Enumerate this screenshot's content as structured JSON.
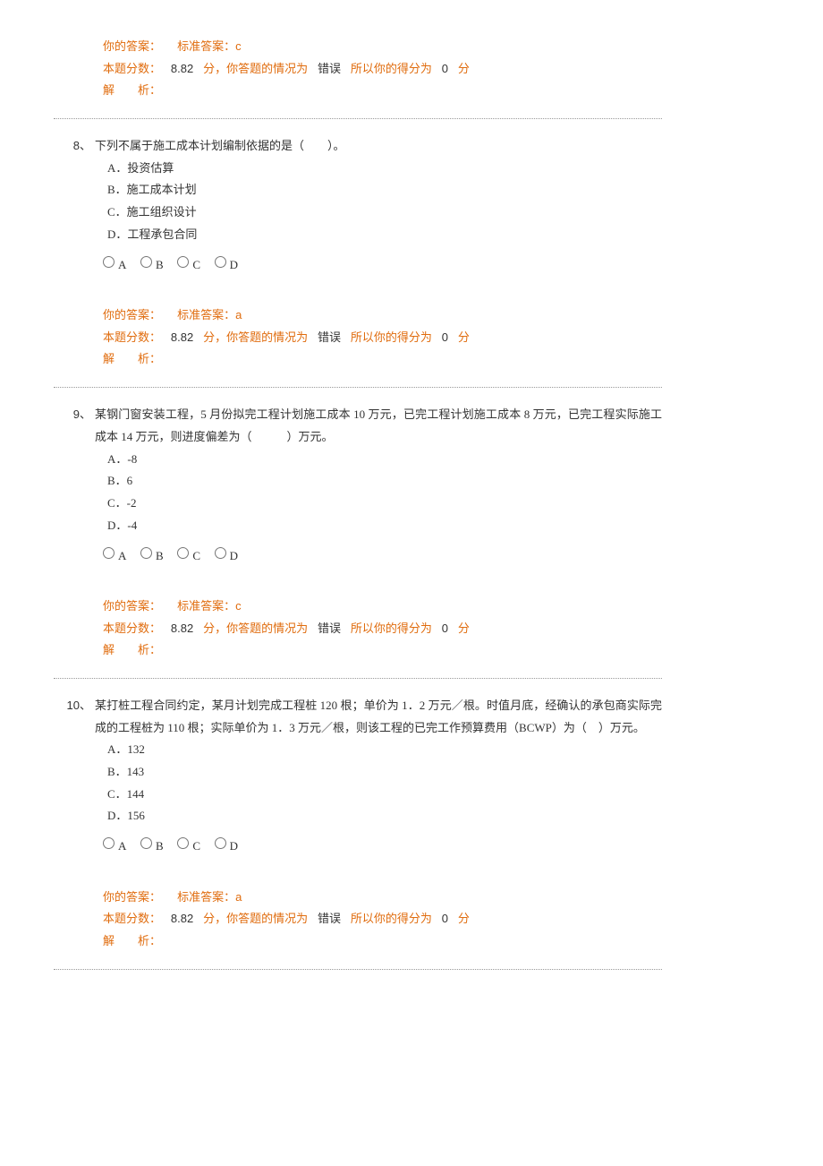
{
  "labels": {
    "your_answer": "你的答案：",
    "standard_answer_prefix": "标准答案：",
    "score_prefix": "本题分数：",
    "points_word": "分",
    "situation_prefix": "，你答题的情况为",
    "incorrect_word": "错误",
    "so_score_prefix": "所以你的得分为",
    "analysis_label": "解　　析：",
    "options_letters": [
      "A",
      "B",
      "C",
      "D"
    ]
  },
  "top_feedback": {
    "standard_answer": "c",
    "score_value": "8.82",
    "earned_score": "0"
  },
  "questions": [
    {
      "number": "8、",
      "stem": "下列不属于施工成本计划编制依据的是（　　）。",
      "options": [
        "A．投资估算",
        "B．施工成本计划",
        "C．施工组织设计",
        "D．工程承包合同"
      ],
      "feedback": {
        "standard_answer": "a",
        "score_value": "8.82",
        "earned_score": "0"
      }
    },
    {
      "number": "9、",
      "stem": "某钢门窗安装工程，5 月份拟完工程计划施工成本 10 万元，已完工程计划施工成本 8 万元，已完工程实际施工成本 14 万元，则进度偏差为（　　　）万元。",
      "options": [
        "A．-8",
        "B．6",
        "C．-2",
        "D．-4"
      ],
      "feedback": {
        "standard_answer": "c",
        "score_value": "8.82",
        "earned_score": "0"
      }
    },
    {
      "number": "10、",
      "stem": "某打桩工程合同约定，某月计划完成工程桩 120 根；单价为 1．2 万元／根。时值月底，经确认的承包商实际完成的工程桩为 110 根；实际单价为 1．3 万元／根，则该工程的已完工作预算费用（BCWP）为（　）万元。",
      "options": [
        "A．132",
        "B．143",
        "C．144",
        "D．156"
      ],
      "feedback": {
        "standard_answer": "a",
        "score_value": "8.82",
        "earned_score": "0"
      }
    }
  ]
}
